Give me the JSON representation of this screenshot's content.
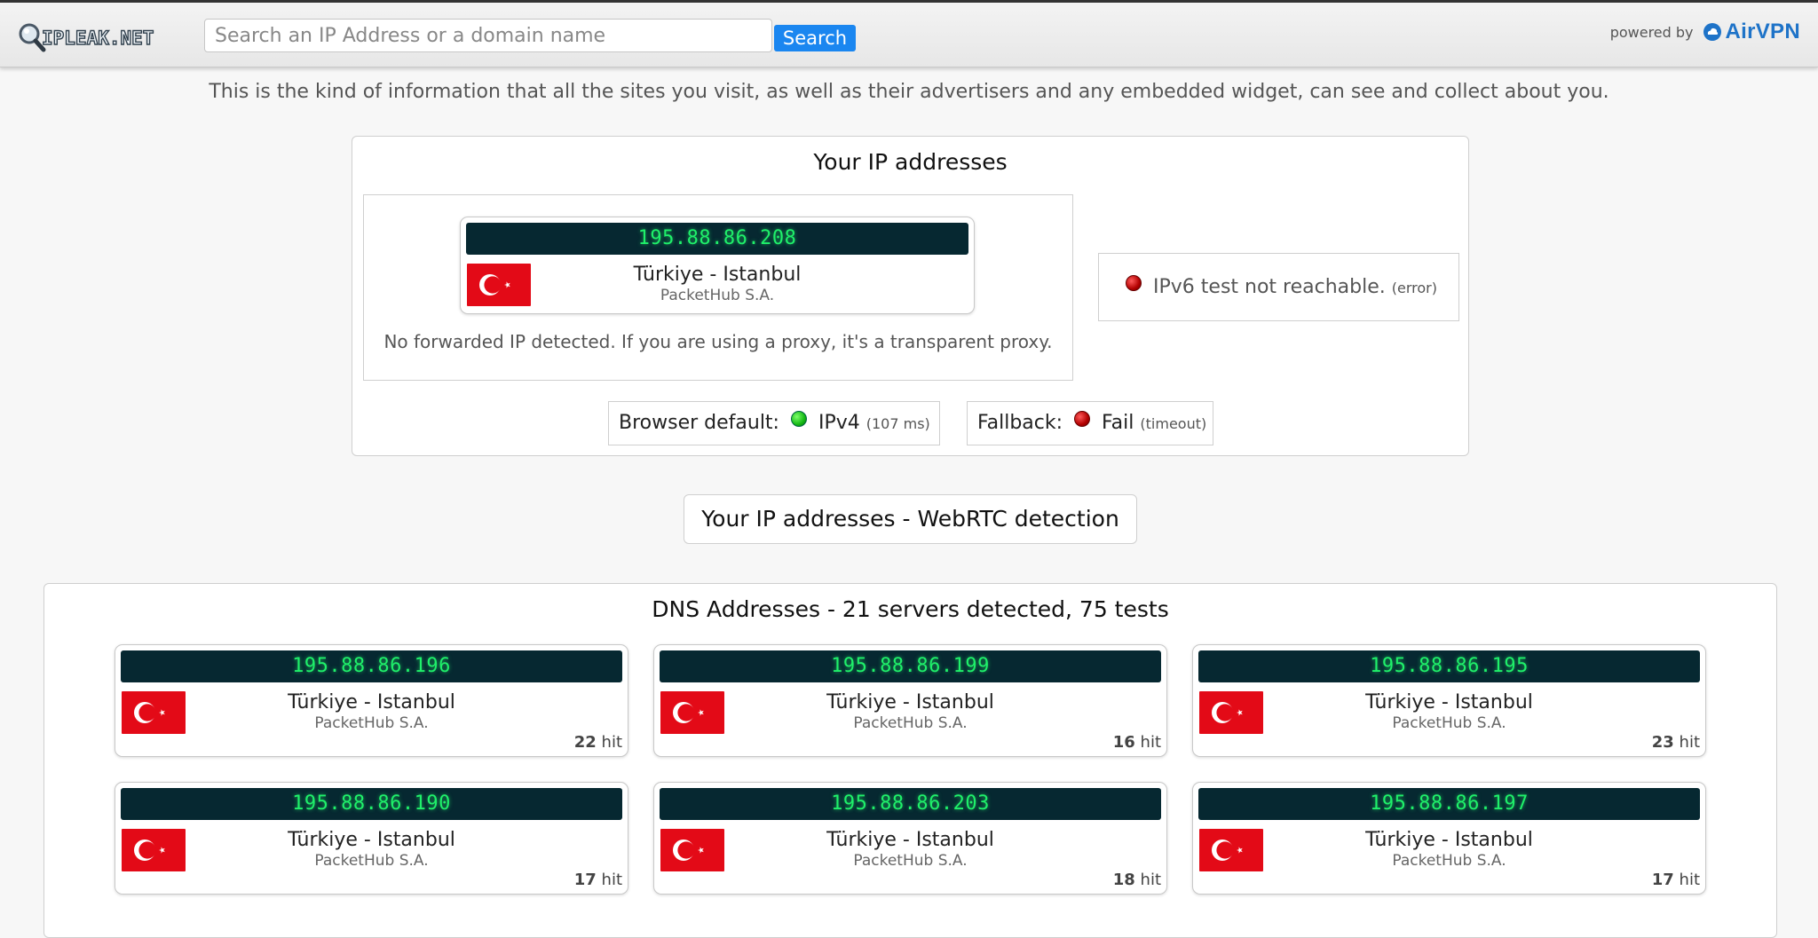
{
  "header": {
    "logo_text": "IPLEAK.NET",
    "search_placeholder": "Search an IP Address or a domain name",
    "search_button": "Search",
    "powered_by": "powered by",
    "partner_name": "AirVPN"
  },
  "intro": "This is the kind of information that all the sites you visit, as well as their advertisers and any embedded widget, can see and collect about you.",
  "ip_section": {
    "title": "Your IP addresses",
    "ipv4": {
      "ip": "195.88.86.208",
      "location": "Türkiye - Istanbul",
      "isp": "PacketHub S.A."
    },
    "forwarded_note": "No forwarded IP detected. If you are using a proxy, it's a transparent proxy.",
    "ipv6": {
      "message": "IPv6 test not reachable.",
      "detail": "(error)",
      "status_color": "#cc0000"
    },
    "browser_default": {
      "label": "Browser default:",
      "value": "IPv4",
      "detail": "(107 ms)",
      "status_color": "#1bbf1b"
    },
    "fallback": {
      "label": "Fallback:",
      "value": "Fail",
      "detail": "(timeout)",
      "status_color": "#cc0000"
    }
  },
  "webrtc": {
    "title": "Your IP addresses - WebRTC detection"
  },
  "dns": {
    "title": "DNS Addresses - 21 servers detected, 75 tests",
    "hit_suffix": "hit",
    "servers": [
      {
        "ip": "195.88.86.196",
        "location": "Türkiye - Istanbul",
        "isp": "PacketHub S.A.",
        "hits": "22"
      },
      {
        "ip": "195.88.86.199",
        "location": "Türkiye - Istanbul",
        "isp": "PacketHub S.A.",
        "hits": "16"
      },
      {
        "ip": "195.88.86.195",
        "location": "Türkiye - Istanbul",
        "isp": "PacketHub S.A.",
        "hits": "23"
      },
      {
        "ip": "195.88.86.190",
        "location": "Türkiye - Istanbul",
        "isp": "PacketHub S.A.",
        "hits": "17"
      },
      {
        "ip": "195.88.86.203",
        "location": "Türkiye - Istanbul",
        "isp": "PacketHub S.A.",
        "hits": "18"
      },
      {
        "ip": "195.88.86.197",
        "location": "Türkiye - Istanbul",
        "isp": "PacketHub S.A.",
        "hits": "17"
      }
    ]
  },
  "colors": {
    "accent": "#1a86f0",
    "ip_bar_bg": "#062831",
    "ip_text": "#1ff06a",
    "flag_red": "#e30a17",
    "airvpn_blue": "#1e73c8"
  }
}
